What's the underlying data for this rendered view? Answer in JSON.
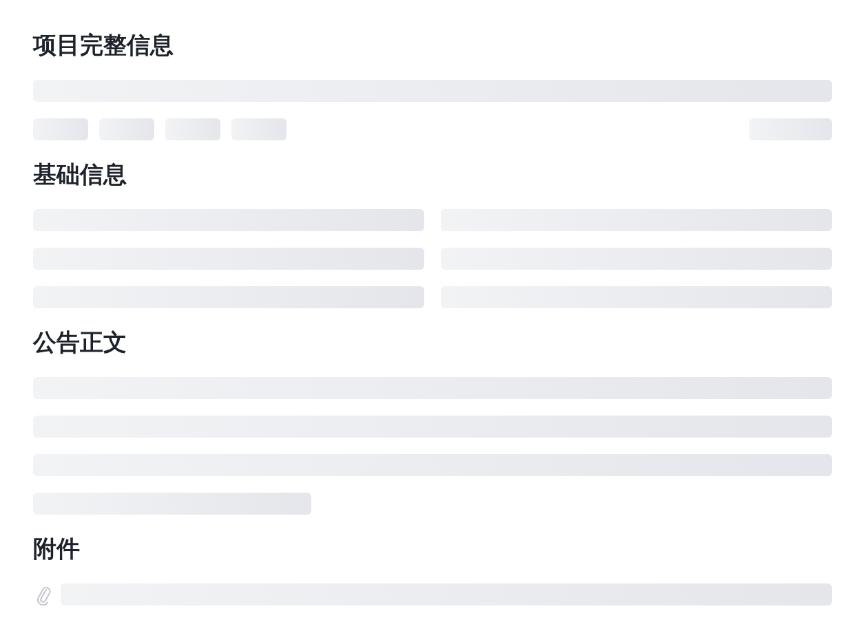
{
  "sections": [
    {
      "title": "项目完整信息",
      "kind": "header"
    },
    {
      "title": "基础信息",
      "kind": "grid"
    },
    {
      "title": "公告正文",
      "kind": "paragraph"
    },
    {
      "title": "附件",
      "kind": "attachment"
    }
  ]
}
